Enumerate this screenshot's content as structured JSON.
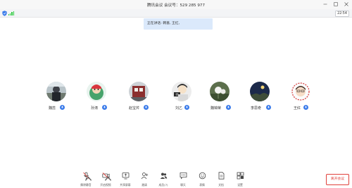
{
  "window": {
    "title": "腾讯会议  会议号：529 285 977"
  },
  "status": {
    "clock": "22:54"
  },
  "toast": {
    "text": "正在讲话: 韩蔷, 王红,"
  },
  "participants": [
    {
      "name": "魏蕊",
      "mic": "active"
    },
    {
      "name": "孙涛",
      "mic": "active"
    },
    {
      "name": "赵宝芹",
      "mic": "active"
    },
    {
      "name": "刘乙",
      "mic": "active"
    },
    {
      "name": "魏锦荣",
      "mic": "active"
    },
    {
      "name": "李思奇",
      "mic": "active"
    },
    {
      "name": "王红",
      "mic": "active"
    }
  ],
  "toolbar": {
    "items": [
      {
        "label": "解除静音",
        "icon": "mic-muted-icon"
      },
      {
        "label": "开启视频",
        "icon": "video-off-icon"
      },
      {
        "label": "共享屏幕",
        "icon": "screen-share-icon"
      },
      {
        "label": "邀请",
        "icon": "invite-icon"
      },
      {
        "label": "成员(7)",
        "icon": "members-icon"
      },
      {
        "label": "聊天",
        "icon": "chat-icon"
      },
      {
        "label": "表情",
        "icon": "emoji-icon"
      },
      {
        "label": "文档",
        "icon": "document-icon"
      },
      {
        "label": "设置",
        "icon": "settings-icon"
      }
    ],
    "leave_label": "离开会议"
  },
  "colors": {
    "accent": "#3a7bea",
    "leave": "#e0413b",
    "toast_bg": "#dbe9fb",
    "signal": "#2ecc40"
  }
}
